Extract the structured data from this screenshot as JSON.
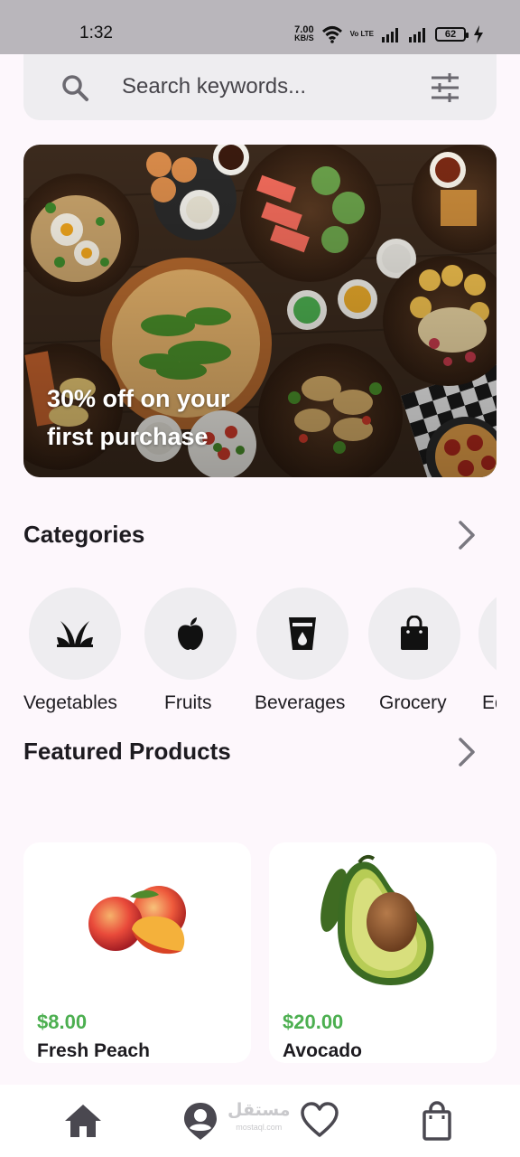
{
  "status_bar": {
    "time": "1:32",
    "net_speed_value": "7.00",
    "net_speed_unit": "KB/S",
    "volte": "Vo LTE",
    "battery": "62"
  },
  "search": {
    "placeholder": "Search keywords..."
  },
  "banner": {
    "line1": "30% off on your",
    "line2": "first purchase"
  },
  "categories_section": {
    "title": "Categories",
    "items": [
      {
        "label": "Vegetables",
        "icon": "sprout-icon"
      },
      {
        "label": "Fruits",
        "icon": "apple-icon"
      },
      {
        "label": "Beverages",
        "icon": "drink-cup-icon"
      },
      {
        "label": "Grocery",
        "icon": "shopping-bag-icon"
      },
      {
        "label": "Ed",
        "icon": "unknown-icon"
      }
    ]
  },
  "featured_section": {
    "title": "Featured Products",
    "products": [
      {
        "price": "$8.00",
        "name": "Fresh Peach"
      },
      {
        "price": "$20.00",
        "name": "Avocado"
      }
    ]
  },
  "bottom_nav": {
    "items": [
      "home-icon",
      "profile-location-icon",
      "heart-icon",
      "shopping-bag-icon"
    ],
    "watermark_ar": "مستقل",
    "watermark_en": "mostaql.com"
  },
  "colors": {
    "accent_price": "#4caf50",
    "background": "#fdf7fc",
    "surface": "#eeedf0"
  }
}
